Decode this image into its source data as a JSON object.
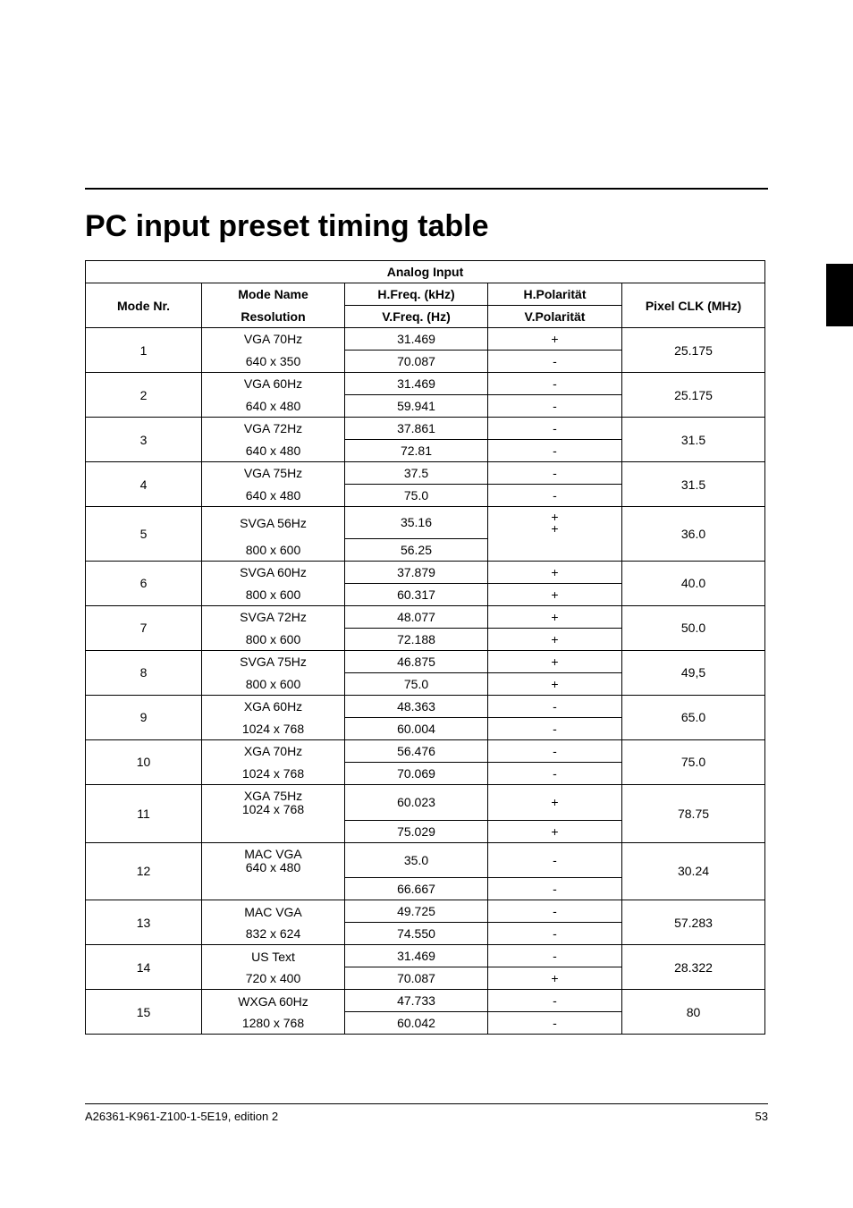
{
  "title": "PC input preset timing table",
  "table": {
    "caption": "Analog Input",
    "headers": {
      "modeNr": "Mode Nr.",
      "modeName": "Mode Name",
      "resolution": "Resolution",
      "hfreq": "H.Freq. (kHz)",
      "vfreq": "V.Freq. (Hz)",
      "hpol": "H.Polarität",
      "vpol": "V.Polarität",
      "pixel": "Pixel CLK (MHz)"
    },
    "rows": [
      {
        "nr": "1",
        "name": "VGA 70Hz",
        "res": "640 x 350",
        "hf": "31.469",
        "vf": "70.087",
        "hp": "+",
        "vp": "-",
        "px": "25.175"
      },
      {
        "nr": "2",
        "name": "VGA 60Hz",
        "res": "640 x 480",
        "hf": "31.469",
        "vf": "59.941",
        "hp": "-",
        "vp": "-",
        "px": "25.175"
      },
      {
        "nr": "3",
        "name": "VGA 72Hz",
        "res": "640 x 480",
        "hf": "37.861",
        "vf": "72.81",
        "hp": "-",
        "vp": "-",
        "px": "31.5"
      },
      {
        "nr": "4",
        "name": "VGA 75Hz",
        "res": "640 x 480",
        "hf": "37.5",
        "vf": "75.0",
        "hp": "-",
        "vp": "-",
        "px": "31.5"
      },
      {
        "nr": "5",
        "name": "SVGA 56Hz",
        "res": "800 x 600",
        "hf": "35.16",
        "vf": "56.25",
        "hp": "+",
        "vp": "+",
        "px": "36.0",
        "vp_shift": true
      },
      {
        "nr": "6",
        "name": "SVGA 60Hz",
        "res": "800 x 600",
        "hf": "37.879",
        "vf": "60.317",
        "hp": "+",
        "vp": "+",
        "px": "40.0"
      },
      {
        "nr": "7",
        "name": "SVGA 72Hz",
        "res": "800 x 600",
        "hf": "48.077",
        "vf": "72.188",
        "hp": "+",
        "vp": "+",
        "px": "50.0"
      },
      {
        "nr": "8",
        "name": "SVGA 75Hz",
        "res": "800 x 600",
        "hf": "46.875",
        "vf": "75.0",
        "hp": "+",
        "vp": "+",
        "px": "49,5"
      },
      {
        "nr": "9",
        "name": "XGA 60Hz",
        "res": "1024 x 768",
        "hf": "48.363",
        "vf": "60.004",
        "hp": "-",
        "vp": "-",
        "px": "65.0"
      },
      {
        "nr": "10",
        "name": "XGA 70Hz",
        "res": "1024 x 768",
        "hf": "56.476",
        "vf": "70.069",
        "hp": "-",
        "vp": "-",
        "px": "75.0"
      },
      {
        "nr": "11",
        "name": "XGA 75Hz",
        "res": "1024 x 768",
        "hf": "60.023",
        "vf": "75.029",
        "hp": "+",
        "vp": "+",
        "px": "78.75",
        "tight_res": true
      },
      {
        "nr": "12",
        "name": "MAC VGA",
        "res": "640 x 480",
        "hf": "35.0",
        "vf": "66.667",
        "hp": "-",
        "vp": "-",
        "px": "30.24",
        "tight_res": true
      },
      {
        "nr": "13",
        "name": "MAC VGA",
        "res": "832 x 624",
        "hf": "49.725",
        "vf": "74.550",
        "hp": "-",
        "vp": "-",
        "px": "57.283"
      },
      {
        "nr": "14",
        "name": "US Text",
        "res": "720 x 400",
        "hf": "31.469",
        "vf": "70.087",
        "hp": "-",
        "vp": "+",
        "px": "28.322"
      },
      {
        "nr": "15",
        "name": "WXGA 60Hz",
        "res": "1280 x 768",
        "hf": "47.733",
        "vf": "60.042",
        "hp": "-",
        "vp": "-",
        "px": "80"
      }
    ]
  },
  "footer": {
    "left": "A26361-K961-Z100-1-5E19, edition 2",
    "right": "53"
  }
}
